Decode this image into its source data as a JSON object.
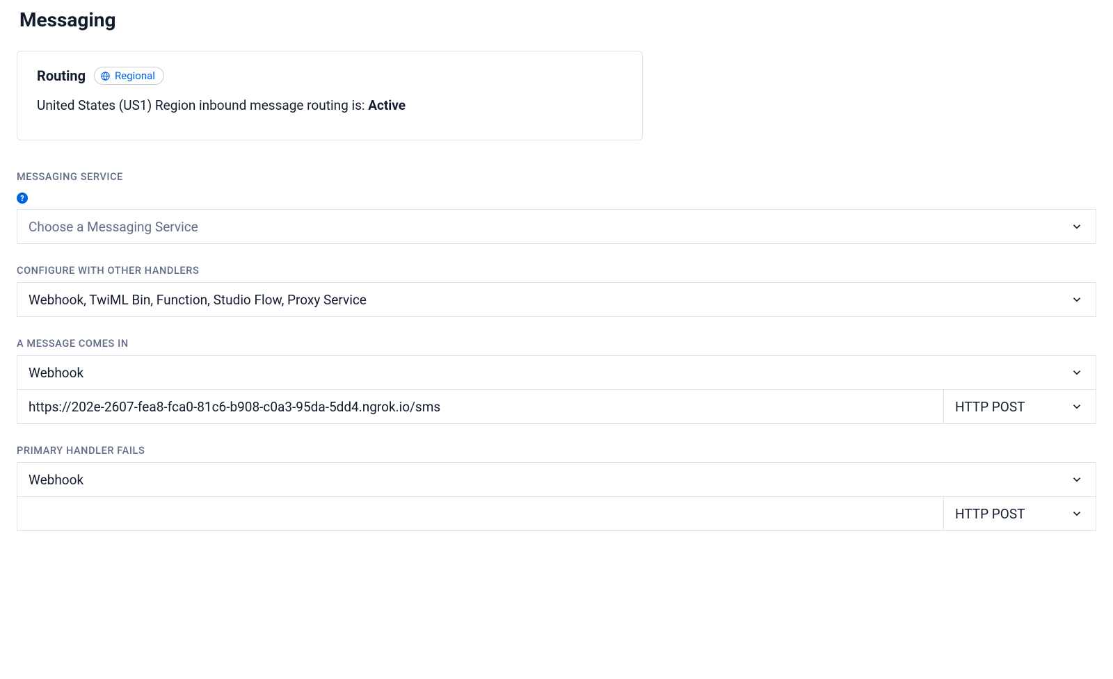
{
  "page": {
    "title": "Messaging"
  },
  "routing": {
    "title": "Routing",
    "badge": "Regional",
    "status_prefix": "United States (US1) Region inbound message routing is: ",
    "status_value": "Active"
  },
  "sections": {
    "messaging_service": {
      "label": "MESSAGING SERVICE",
      "help_glyph": "?",
      "placeholder": "Choose a Messaging Service",
      "value": ""
    },
    "configure_handlers": {
      "label": "CONFIGURE WITH OTHER HANDLERS",
      "value": "Webhook, TwiML Bin, Function, Studio Flow, Proxy Service"
    },
    "message_comes_in": {
      "label": "A MESSAGE COMES IN",
      "type_value": "Webhook",
      "url_value": "https://202e-2607-fea8-fca0-81c6-b908-c0a3-95da-5dd4.ngrok.io/sms",
      "method_value": "HTTP POST"
    },
    "primary_handler_fails": {
      "label": "PRIMARY HANDLER FAILS",
      "type_value": "Webhook",
      "url_value": "",
      "method_value": "HTTP POST"
    }
  }
}
